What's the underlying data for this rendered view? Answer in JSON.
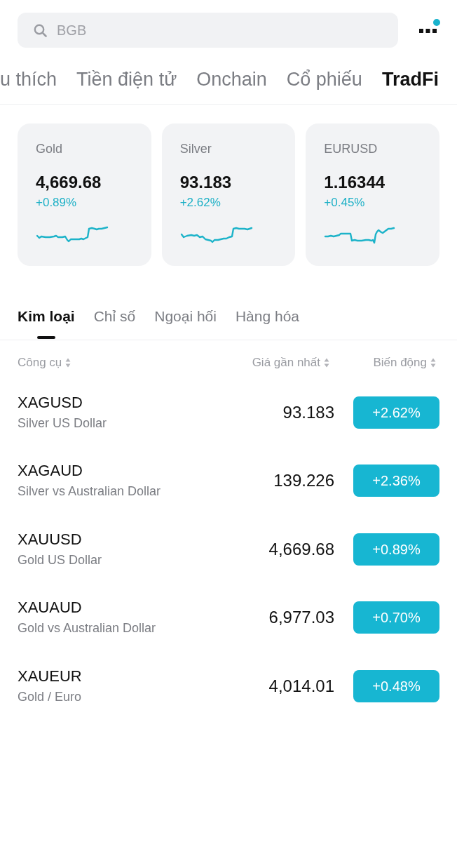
{
  "search": {
    "placeholder": "BGB"
  },
  "menu": {
    "notification_dot": true
  },
  "market_tabs": [
    {
      "label": "u thích",
      "selected": false
    },
    {
      "label": "Tiền điện tử",
      "selected": false
    },
    {
      "label": "Onchain",
      "selected": false
    },
    {
      "label": "Cổ phiếu",
      "selected": false
    },
    {
      "label": "TradFi",
      "selected": true
    }
  ],
  "cards": [
    {
      "name": "Gold",
      "price": "4,669.68",
      "change": "+0.89%"
    },
    {
      "name": "Silver",
      "price": "93.183",
      "change": "+2.62%"
    },
    {
      "name": "EURUSD",
      "price": "1.16344",
      "change": "+0.45%"
    }
  ],
  "category_tabs": [
    {
      "label": "Kim loại",
      "selected": true
    },
    {
      "label": "Chỉ số",
      "selected": false
    },
    {
      "label": "Ngoại hối",
      "selected": false
    },
    {
      "label": "Hàng hóa",
      "selected": false
    }
  ],
  "table": {
    "columns": [
      "Công cụ",
      "Giá gần nhất",
      "Biến động"
    ],
    "rows": [
      {
        "symbol": "XAGUSD",
        "name": "Silver US Dollar",
        "price": "93.183",
        "change": "+2.62%"
      },
      {
        "symbol": "XAGAUD",
        "name": "Silver vs Australian Dollar",
        "price": "139.226",
        "change": "+2.36%"
      },
      {
        "symbol": "XAUUSD",
        "name": "Gold US Dollar",
        "price": "4,669.68",
        "change": "+0.89%"
      },
      {
        "symbol": "XAUAUD",
        "name": "Gold vs Australian Dollar",
        "price": "6,977.03",
        "change": "+0.70%"
      },
      {
        "symbol": "XAUEUR",
        "name": "Gold / Euro",
        "price": "4,014.01",
        "change": "+0.48%"
      }
    ]
  }
}
